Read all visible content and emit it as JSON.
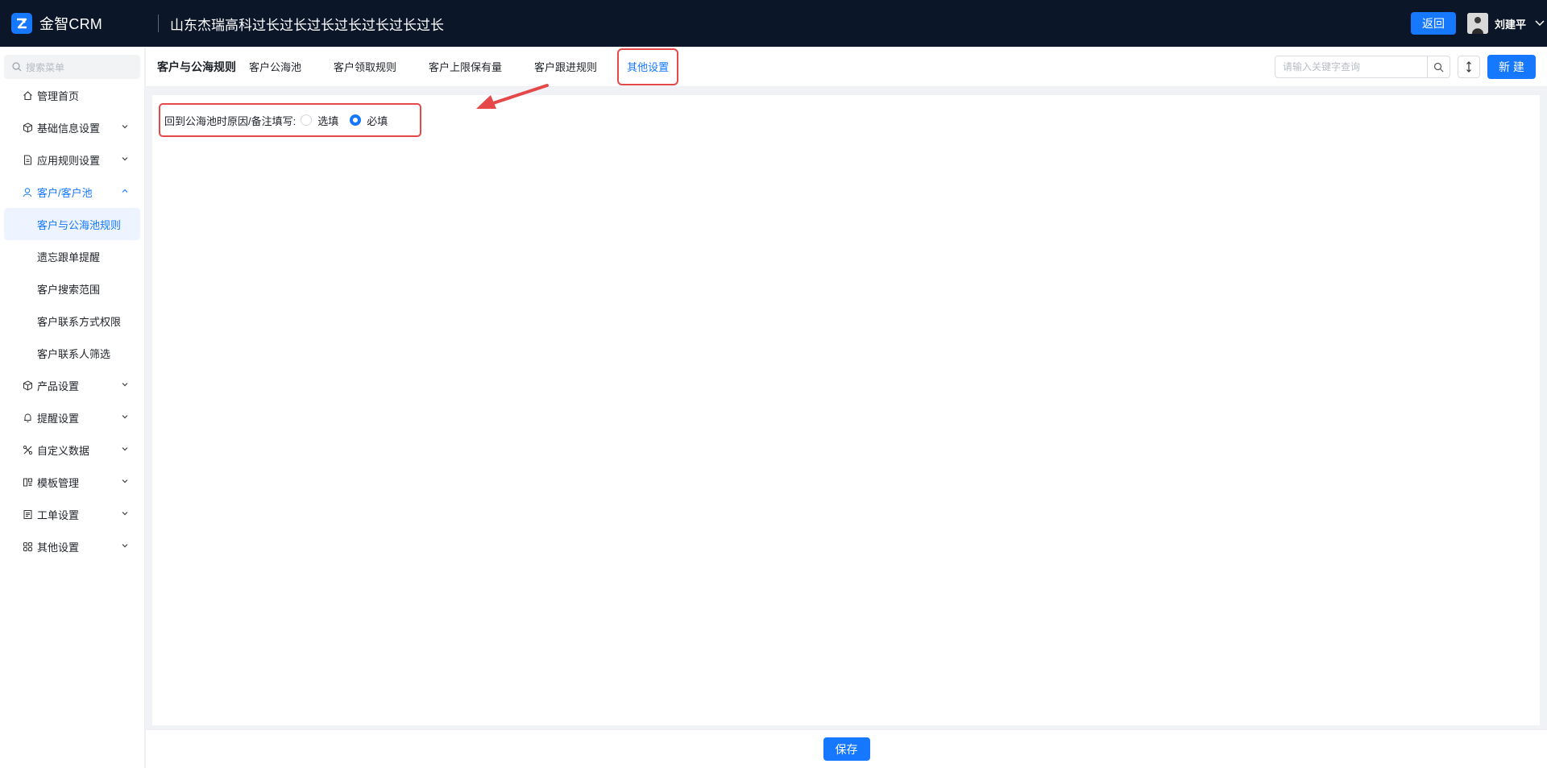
{
  "app": {
    "logo_text": "金智CRM",
    "company_title": "山东杰瑞高科过长过长过长过长过长过长过长",
    "back_label": "返回",
    "user_name": "刘建平"
  },
  "sidebar": {
    "search_placeholder": "搜索菜单",
    "items": [
      {
        "label": "管理首页",
        "icon": "home-icon"
      },
      {
        "label": "基础信息设置",
        "icon": "cube-icon"
      },
      {
        "label": "应用规则设置",
        "icon": "document-icon"
      },
      {
        "label": "客户/客户池",
        "icon": "user-icon"
      },
      {
        "label": "产品设置",
        "icon": "cube-icon"
      },
      {
        "label": "提醒设置",
        "icon": "bell-icon"
      },
      {
        "label": "自定义数据",
        "icon": "tools-icon"
      },
      {
        "label": "模板管理",
        "icon": "template-icon"
      },
      {
        "label": "工单设置",
        "icon": "ticket-icon"
      },
      {
        "label": "其他设置",
        "icon": "apps-icon"
      }
    ],
    "sub_items": [
      {
        "label": "客户与公海池规则"
      },
      {
        "label": "遗忘跟单提醒"
      },
      {
        "label": "客户搜索范围"
      },
      {
        "label": "客户联系方式权限"
      },
      {
        "label": "客户联系人筛选"
      }
    ]
  },
  "tabbar": {
    "title": "客户与公海规则",
    "tabs": [
      {
        "label": "客户公海池"
      },
      {
        "label": "客户领取规则"
      },
      {
        "label": "客户上限保有量"
      },
      {
        "label": "客户跟进规则"
      },
      {
        "label": "其他设置"
      }
    ],
    "search_placeholder": "请输入关键字查询",
    "new_label": "新 建"
  },
  "setting": {
    "label": "回到公海池时原因/备注填写:",
    "options": [
      {
        "label": "选填",
        "checked": false
      },
      {
        "label": "必填",
        "checked": true
      }
    ]
  },
  "footer": {
    "save_label": "保存"
  },
  "colors": {
    "accent": "#1677ff",
    "topbar": "#0c1629",
    "annotation": "#e54848"
  }
}
